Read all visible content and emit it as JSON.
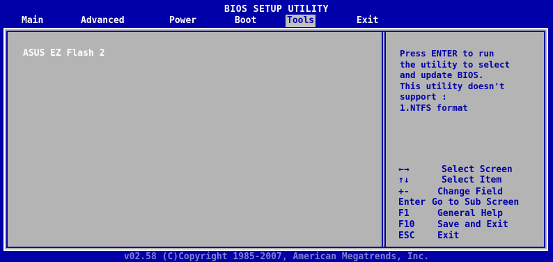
{
  "title": "BIOS SETUP UTILITY",
  "menu": [
    "Main",
    "Advanced",
    "Power",
    "Boot",
    "Tools",
    "Exit"
  ],
  "active_menu": "Tools",
  "items": {
    "ez_flash": "ASUS EZ Flash 2"
  },
  "help_lines": [
    "Press ENTER to run",
    "the utility to select",
    "and update BIOS.",
    "This utility doesn't",
    "support :",
    "1.NTFS format"
  ],
  "key_help": [
    {
      "key": "←→",
      "desc": "Select Screen"
    },
    {
      "key": "↑↓",
      "desc": "Select Item"
    },
    {
      "key": "+-",
      "desc": "Change Field"
    },
    {
      "key": "Enter",
      "desc": "Go to Sub Screen"
    },
    {
      "key": "F1",
      "desc": "General Help"
    },
    {
      "key": "F10",
      "desc": "Save and Exit"
    },
    {
      "key": "ESC",
      "desc": "Exit"
    }
  ],
  "footer": "v02.58 (C)Copyright 1985-2007, American Megatrends, Inc.",
  "colors": {
    "background": "#0000a8",
    "panel": "#b4b4b4",
    "text_light": "#ffffff",
    "highlight": "#c0c0c0"
  }
}
